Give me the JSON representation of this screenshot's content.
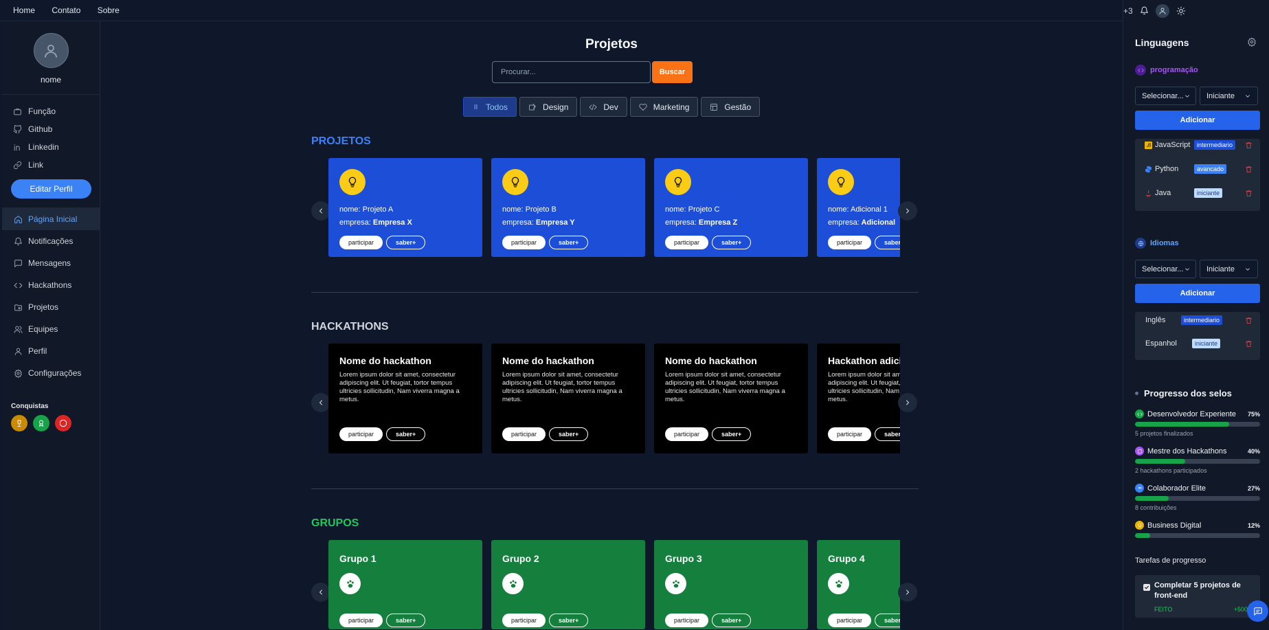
{
  "topbar": {
    "nav": [
      "Home",
      "Contato",
      "Sobre"
    ],
    "notification_count": "+3"
  },
  "sidebar": {
    "profile_name": "nome",
    "links": [
      {
        "label": "Função",
        "icon": "briefcase-icon"
      },
      {
        "label": "Github",
        "icon": "github-icon"
      },
      {
        "label": "Linkedin",
        "icon": "linkedin-icon"
      },
      {
        "label": "Link",
        "icon": "link-icon"
      }
    ],
    "edit_button": "Editar Perfil",
    "menu": [
      {
        "label": "Página Inicial",
        "icon": "home-icon",
        "active": true
      },
      {
        "label": "Notificações",
        "icon": "bell-icon"
      },
      {
        "label": "Mensagens",
        "icon": "message-icon"
      },
      {
        "label": "Hackathons",
        "icon": "code-icon"
      },
      {
        "label": "Projetos",
        "icon": "folder-icon"
      },
      {
        "label": "Equipes",
        "icon": "users-icon"
      },
      {
        "label": "Perfil",
        "icon": "user-icon"
      },
      {
        "label": "Configurações",
        "icon": "gear-icon"
      }
    ],
    "achievements_title": "Conquistas",
    "achievements": [
      {
        "icon": "trophy-icon",
        "color": "#ca8a04"
      },
      {
        "icon": "award-icon",
        "color": "#16a34a"
      },
      {
        "icon": "badge-icon",
        "color": "#dc2626"
      }
    ]
  },
  "main": {
    "title": "Projetos",
    "search": {
      "placeholder": "Procurar...",
      "button": "Buscar"
    },
    "filters": [
      {
        "label": "Todos",
        "icon": "pause-icon",
        "active": true
      },
      {
        "label": "Design",
        "icon": "design-icon"
      },
      {
        "label": "Dev",
        "icon": "code-icon"
      },
      {
        "label": "Marketing",
        "icon": "heart-icon"
      },
      {
        "label": "Gestão",
        "icon": "layout-icon"
      }
    ],
    "projects": {
      "title": "PROJETOS",
      "title_color": "#3b82f6",
      "cards": [
        {
          "name": "nome: Projeto A",
          "company_key": "empresa:",
          "company": "Empresa X"
        },
        {
          "name": "nome: Projeto B",
          "company_key": "empresa:",
          "company": "Empresa Y"
        },
        {
          "name": "nome: Projeto C",
          "company_key": "empresa:",
          "company": "Empresa Z"
        },
        {
          "name": "nome: Adicional 1",
          "company_key": "empresa:",
          "company": "Adicional"
        }
      ]
    },
    "hackathons": {
      "title": "HACKATHONS",
      "title_color": "#d1d5db",
      "cards": [
        {
          "title": "Nome do hackathon",
          "desc": "Lorem ipsum dolor sit amet, consectetur adipiscing elit. Ut feugiat, tortor tempus ultricies sollicitudin, Nam viverra magna a metus."
        },
        {
          "title": "Nome do hackathon",
          "desc": "Lorem ipsum dolor sit amet, consectetur adipiscing elit. Ut feugiat, tortor tempus ultricies sollicitudin, Nam viverra magna a metus."
        },
        {
          "title": "Nome do hackathon",
          "desc": "Lorem ipsum dolor sit amet, consectetur adipiscing elit. Ut feugiat, tortor tempus ultricies sollicitudin, Nam viverra magna a metus."
        },
        {
          "title": "Hackathon adicional",
          "desc": "Lorem ipsum dolor sit amet, consectetur adipiscing elit. Ut feugiat, tortor tempus ultricies sollicitudin, Nam viverra magna a metus."
        }
      ]
    },
    "groups": {
      "title": "GRUPOS",
      "title_color": "#22c55e",
      "cards": [
        {
          "title": "Grupo 1"
        },
        {
          "title": "Grupo 2"
        },
        {
          "title": "Grupo 3"
        },
        {
          "title": "Grupo 4"
        }
      ]
    },
    "card_buttons": {
      "join": "participar",
      "more": "saber+"
    }
  },
  "right_panel": {
    "title": "Linguagens",
    "programming": {
      "label": "programação",
      "color": "#a855f7",
      "select_placeholder": "Selecionar...",
      "level": "Iniciante",
      "add_button": "Adicionar",
      "items": [
        {
          "name": "JavaScript",
          "level": "intermediario",
          "icon": "javascript-icon"
        },
        {
          "name": "Python",
          "level": "avancado",
          "icon": "python-icon"
        },
        {
          "name": "Java",
          "level": "iniciante",
          "icon": "java-icon"
        }
      ]
    },
    "languages": {
      "label": "Idiomas",
      "color": "#3b82f6",
      "select_placeholder": "Selecionar...",
      "level": "Iniciante",
      "add_button": "Adicionar",
      "items": [
        {
          "name": "Inglês",
          "level": "intermediario"
        },
        {
          "name": "Espanhol",
          "level": "iniciante"
        }
      ]
    },
    "badges_title": "Progresso dos selos",
    "badges": [
      {
        "name": "Desenvolvedor Experiente",
        "percent": 75,
        "percent_label": "75%",
        "sub": "5 projetos finalizados",
        "icon": "code-badge-icon",
        "icon_color": "#16a34a"
      },
      {
        "name": "Mestre dos Hackathons",
        "percent": 40,
        "percent_label": "40%",
        "sub": "2 hackathons participados",
        "icon": "hackathon-badge-icon",
        "icon_color": "#a855f7"
      },
      {
        "name": "Colaborador Elite",
        "percent": 27,
        "percent_label": "27%",
        "sub": "8 contribuições",
        "icon": "team-badge-icon",
        "icon_color": "#3b82f6"
      },
      {
        "name": "Business Digital",
        "percent": 12,
        "percent_label": "12%",
        "sub": "",
        "icon": "bulb-badge-icon",
        "icon_color": "#eab308"
      }
    ],
    "tasks_title": "Tarefas de progresso",
    "task": {
      "title": "Completar 5 projetos de front-end",
      "status": "FEITO",
      "points": "+500"
    }
  }
}
